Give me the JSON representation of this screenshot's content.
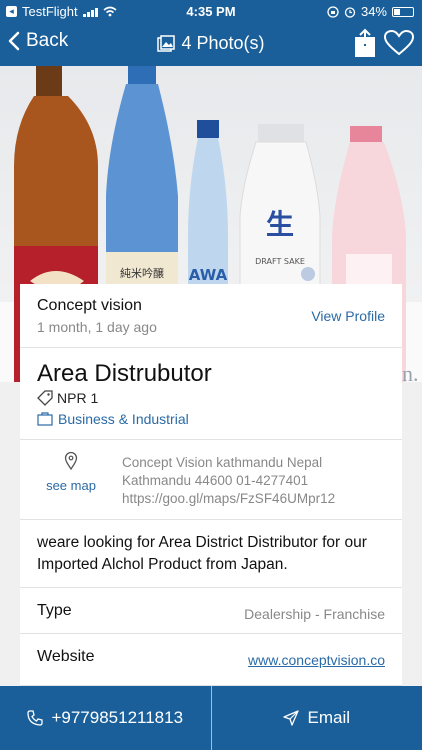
{
  "status_bar": {
    "back_app_label": "TestFlight",
    "time": "4:35 PM",
    "battery": "34%"
  },
  "nav": {
    "back_label": "Back",
    "title": "4 Photo(s)"
  },
  "poster": {
    "name": "Concept vision",
    "posted": "1 month, 1 day ago",
    "view_profile_label": "View Profile"
  },
  "listing": {
    "title": "Area Distrubutor",
    "price": "NPR 1",
    "category": "Business & Industrial"
  },
  "location": {
    "see_map_label": "see map",
    "address_line1": "Concept Vision kathmandu Nepal",
    "address_line2": "Kathmandu 44600 01-4277401",
    "address_line3": "https://goo.gl/maps/FzSF46UMpr12"
  },
  "description": "weare looking for Area District Distributor for our Imported Alchol Product from Japan.",
  "details": [
    {
      "label": "Type",
      "value": "Dealership - Franchise"
    },
    {
      "label": "Website",
      "value": "www.conceptvision.co"
    }
  ],
  "bottom_actions": {
    "phone_label": "+9779851211813",
    "email_label": "Email"
  },
  "hero_image": {
    "bottle_labels": [
      "純米吟醸",
      "AWA",
      "生",
      "DRAFT SAKE"
    ],
    "watermark_text": "n."
  },
  "colors": {
    "primary": "#1a5f9a",
    "link": "#2a6aa6"
  }
}
